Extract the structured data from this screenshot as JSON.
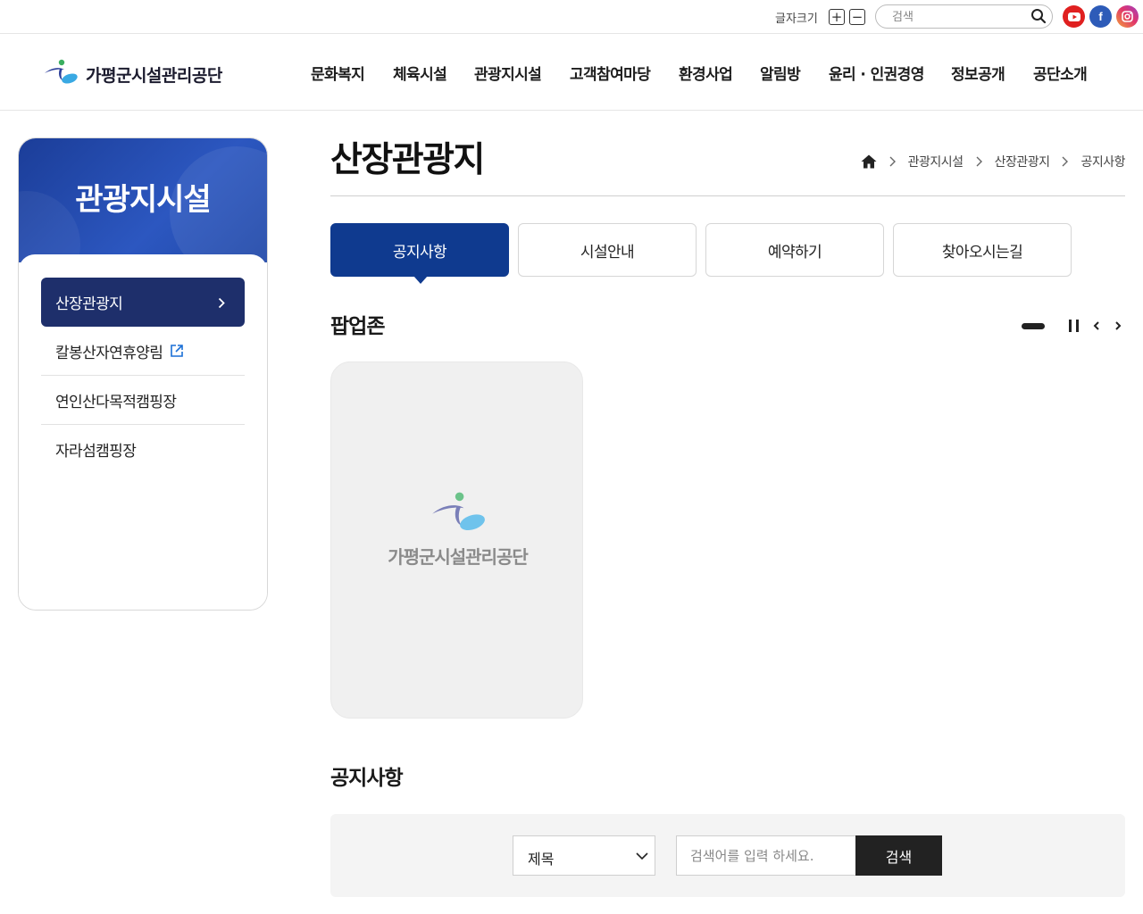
{
  "utility": {
    "font_size_label": "글자크기",
    "font_plus": "+",
    "font_minus": "−",
    "search_placeholder": "검색",
    "sns": {
      "facebook": "f"
    }
  },
  "header": {
    "logo_text": "가평군시설관리공단",
    "nav": [
      "문화복지",
      "체육시설",
      "관광지시설",
      "고객참여마당",
      "환경사업",
      "알림방",
      "윤리 · 인권경영",
      "정보공개",
      "공단소개"
    ]
  },
  "sidebar": {
    "title": "관광지시설",
    "items": [
      {
        "label": "산장관광지",
        "active": true
      },
      {
        "label": "칼봉산자연휴양림",
        "external": true
      },
      {
        "label": "연인산다목적캠핑장"
      },
      {
        "label": "자라섬캠핑장"
      }
    ]
  },
  "page": {
    "title": "산장관광지",
    "breadcrumb": [
      "관광지시설",
      "산장관광지",
      "공지사항"
    ]
  },
  "tabs": [
    {
      "label": "공지사항",
      "active": true
    },
    {
      "label": "시설안내"
    },
    {
      "label": "예약하기"
    },
    {
      "label": "찾아오시는길"
    }
  ],
  "popup_zone": {
    "title": "팝업존",
    "card_logo_text": "가평군시설관리공단"
  },
  "notice": {
    "title": "공지사항",
    "search_field_selected": "제목",
    "search_placeholder": "검색어를 입력 하세요.",
    "search_button": "검색"
  },
  "colors": {
    "primary": "#0f3a8f",
    "sidebar_active": "#1e2f6b",
    "sidebar_header": "#2c57c0",
    "youtube": "#e02020",
    "facebook": "#2d5bb8"
  }
}
